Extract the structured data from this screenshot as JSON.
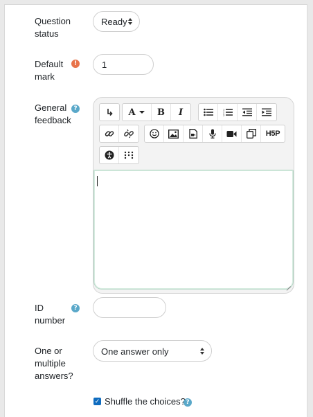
{
  "question_status": {
    "label_line1": "Question",
    "label_line2": "status",
    "value": "Ready"
  },
  "default_mark": {
    "label_line1": "Default",
    "label_line2": "mark",
    "value": "1"
  },
  "general_feedback": {
    "label_line1": "General",
    "label_line2": "feedback"
  },
  "toolbar": {
    "row1": [
      "redo-arrow",
      "font",
      "bold",
      "italic",
      "bullet-list",
      "numbered-list",
      "outdent",
      "indent"
    ],
    "row2": [
      "link",
      "unlink",
      "emoji",
      "image",
      "media",
      "record-audio",
      "record-video",
      "manage-files",
      "h5p"
    ],
    "row3": [
      "accessibility-checker",
      "screenreader-helper"
    ],
    "bold_glyph": "B",
    "italic_glyph": "I",
    "font_glyph": "A",
    "h5p_glyph": "H5P"
  },
  "id_number": {
    "label_line1": "ID",
    "label_line2": "number",
    "value": ""
  },
  "answers": {
    "label_line1": "One or",
    "label_line2": "multiple",
    "label_line3": "answers?",
    "value": "One answer only"
  },
  "shuffle": {
    "label": "Shuffle the choices?",
    "checked": true
  },
  "colors": {
    "help": "#5aa8c9",
    "required": "#e8734a",
    "checkbox": "#0f6cbf"
  }
}
